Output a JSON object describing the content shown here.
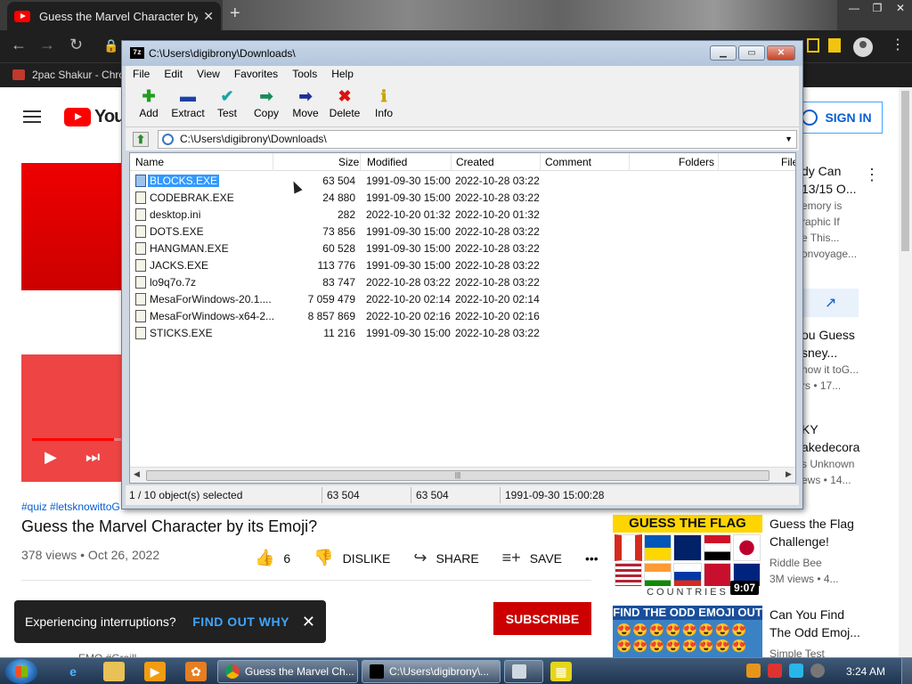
{
  "browser": {
    "tab_title": "Guess the Marvel Character by its Emoji?",
    "new_tab": "+",
    "bookmark": "2pac Shakur - Chro"
  },
  "youtube": {
    "logo_text": "YouTube",
    "sign_in": "SIGN IN",
    "hashtags": "#quiz #letsknowittoG",
    "title": "Guess the Marvel Character by its Emoji?",
    "views": "378 views • Oct 26, 2022",
    "likes": "6",
    "dislike": "DISLIKE",
    "share": "SHARE",
    "save": "SAVE",
    "more": "•••",
    "subscribe": "SUBSCRIBE",
    "channel_partial": "EMO #Graill",
    "player_progress": 0.15,
    "toast": {
      "message": "Experiencing interruptions?",
      "link": "FIND OUT WHY"
    },
    "recs": [
      {
        "l1": "dy Can",
        "l2": "13/15 O...",
        "l3": "emory is",
        "l4": "raphic If",
        "l5": "e This...",
        "l6": "onvoyage..."
      },
      {
        "l1": "ou Guess",
        "l2": "sney...",
        "l3": "now it toG...",
        "l4": "rs • 17..."
      },
      {
        "l1": "KY",
        "l2": "akedecora",
        "l3": "s Unknown",
        "l4": "ews • 14..."
      }
    ],
    "flag_video": {
      "thumb_title": "GUESS THE FLAG",
      "thumb_sub": "COUNTRIES",
      "duration": "9:07",
      "title_l1": "Guess the Flag",
      "title_l2": "Challenge!",
      "channel": "Riddle Bee",
      "meta": "3M views • 4..."
    },
    "emoji_video": {
      "thumb_title": "FIND THE ODD EMOJI OUT",
      "faces": "😍😍😍😍😍😍😍😍 😍😍😍😍😍😍😍😍",
      "title_l1": "Can You Find",
      "title_l2": "The Odd Emoj...",
      "channel": "Simple Test"
    }
  },
  "zip": {
    "icon": "7z",
    "title": "C:\\Users\\digibrony\\Downloads\\",
    "menu": [
      "File",
      "Edit",
      "View",
      "Favorites",
      "Tools",
      "Help"
    ],
    "toolbar": [
      {
        "label": "Add",
        "glyph": "✚",
        "color": "#1ea01e",
        "icon": "add-icon"
      },
      {
        "label": "Extract",
        "glyph": "▬",
        "color": "#1c3fa8",
        "icon": "extract-icon"
      },
      {
        "label": "Test",
        "glyph": "✔",
        "color": "#1aa5a5",
        "icon": "test-icon"
      },
      {
        "label": "Copy",
        "glyph": "➡",
        "color": "#1c8a5a",
        "icon": "copy-icon"
      },
      {
        "label": "Move",
        "glyph": "➡",
        "color": "#1c2f9a",
        "icon": "move-icon"
      },
      {
        "label": "Delete",
        "glyph": "✖",
        "color": "#d11",
        "icon": "delete-icon"
      },
      {
        "label": "Info",
        "glyph": "ℹ",
        "color": "#c9a400",
        "icon": "info-icon"
      }
    ],
    "address": "C:\\Users\\digibrony\\Downloads\\",
    "columns": {
      "name": "Name",
      "size": "Size",
      "modified": "Modified",
      "created": "Created",
      "comment": "Comment",
      "folders": "Folders",
      "files": "File"
    },
    "files": [
      {
        "name": "BLOCKS.EXE",
        "size": "63 504",
        "modified": "1991-09-30 15:00",
        "created": "2022-10-28 03:22"
      },
      {
        "name": "CODEBRAK.EXE",
        "size": "24 880",
        "modified": "1991-09-30 15:00",
        "created": "2022-10-28 03:22"
      },
      {
        "name": "desktop.ini",
        "size": "282",
        "modified": "2022-10-20 01:32",
        "created": "2022-10-20 01:32"
      },
      {
        "name": "DOTS.EXE",
        "size": "73 856",
        "modified": "1991-09-30 15:00",
        "created": "2022-10-28 03:22"
      },
      {
        "name": "HANGMAN.EXE",
        "size": "60 528",
        "modified": "1991-09-30 15:00",
        "created": "2022-10-28 03:22"
      },
      {
        "name": "JACKS.EXE",
        "size": "113 776",
        "modified": "1991-09-30 15:00",
        "created": "2022-10-28 03:22"
      },
      {
        "name": "lo9q7o.7z",
        "size": "83 747",
        "modified": "2022-10-28 03:22",
        "created": "2022-10-28 03:22"
      },
      {
        "name": "MesaForWindows-20.1....",
        "size": "7 059 479",
        "modified": "2022-10-20 02:14",
        "created": "2022-10-20 02:14"
      },
      {
        "name": "MesaForWindows-x64-2...",
        "size": "8 857 869",
        "modified": "2022-10-20 02:16",
        "created": "2022-10-20 02:16"
      },
      {
        "name": "STICKS.EXE",
        "size": "11 216",
        "modified": "1991-09-30 15:00",
        "created": "2022-10-28 03:22"
      }
    ],
    "status": {
      "selected": "1 / 10 object(s) selected",
      "size": "63 504",
      "packed": "63 504",
      "date": "1991-09-30 15:00:28"
    }
  },
  "taskbar": {
    "chrome_task": "Guess the Marvel Ch...",
    "zip_task": "C:\\Users\\digibrony\\...",
    "clock": "3:24 AM"
  }
}
